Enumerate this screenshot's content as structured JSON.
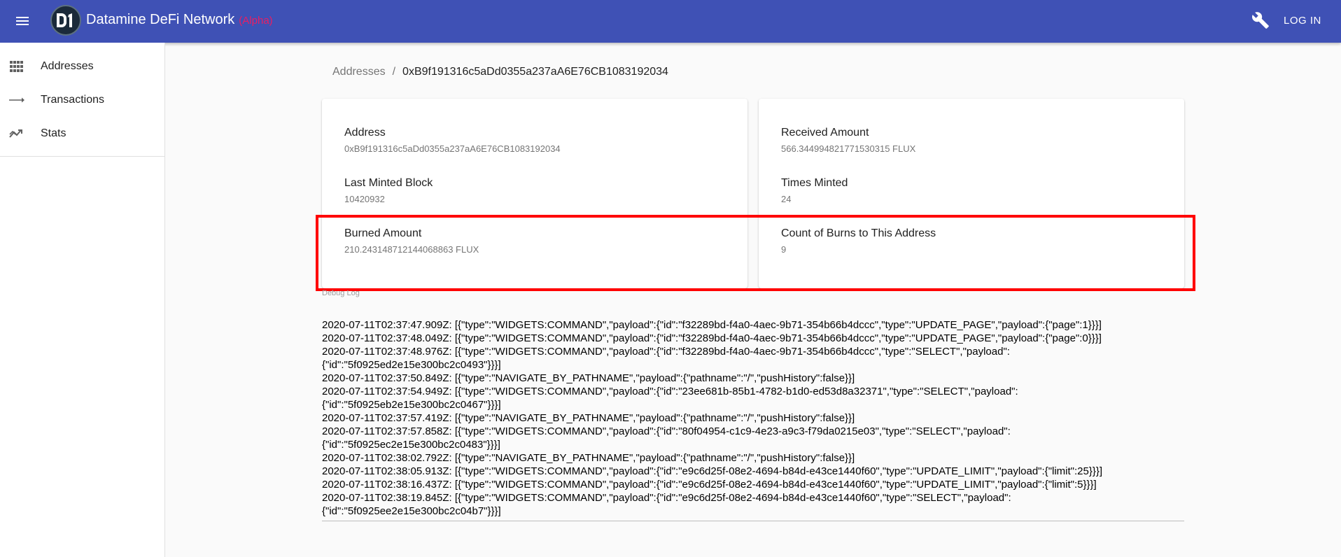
{
  "app": {
    "title": "Datamine DeFi Network",
    "badge": "(Alpha)",
    "login_label": "LOG IN",
    "logo_text": "D1"
  },
  "sidebar": {
    "items": [
      {
        "label": "Addresses",
        "icon": "grid-icon"
      },
      {
        "label": "Transactions",
        "icon": "arrow-right-icon"
      },
      {
        "label": "Stats",
        "icon": "trending-icon"
      }
    ]
  },
  "breadcrumb": {
    "parent": "Addresses",
    "separator": "/",
    "current": "0xB9f191316c5aDd0355a237aA6E76CB1083192034"
  },
  "details": {
    "address_label": "Address",
    "address_value": "0xB9f191316c5aDd0355a237aA6E76CB1083192034",
    "last_minted_label": "Last Minted Block",
    "last_minted_value": "10420932",
    "burned_label": "Burned Amount",
    "burned_value": "210.243148712144068863 FLUX",
    "received_label": "Received Amount",
    "received_value": "566.344994821771530315 FLUX",
    "times_minted_label": "Times Minted",
    "times_minted_value": "24",
    "burn_count_label": "Count of Burns to This Address",
    "burn_count_value": "9"
  },
  "debug": {
    "label": "Debug Log",
    "lines": [
      "2020-07-11T02:37:47.909Z: [{\"type\":\"WIDGETS:COMMAND\",\"payload\":{\"id\":\"f32289bd-f4a0-4aec-9b71-354b66b4dccc\",\"type\":\"UPDATE_PAGE\",\"payload\":{\"page\":1}}}]",
      "2020-07-11T02:37:48.049Z: [{\"type\":\"WIDGETS:COMMAND\",\"payload\":{\"id\":\"f32289bd-f4a0-4aec-9b71-354b66b4dccc\",\"type\":\"UPDATE_PAGE\",\"payload\":{\"page\":0}}}]",
      "2020-07-11T02:37:48.976Z: [{\"type\":\"WIDGETS:COMMAND\",\"payload\":{\"id\":\"f32289bd-f4a0-4aec-9b71-354b66b4dccc\",\"type\":\"SELECT\",\"payload\":{\"id\":\"5f0925ed2e15e300bc2c0493\"}}}]",
      "2020-07-11T02:37:50.849Z: [{\"type\":\"NAVIGATE_BY_PATHNAME\",\"payload\":{\"pathname\":\"/\",\"pushHistory\":false}}]",
      "2020-07-11T02:37:54.949Z: [{\"type\":\"WIDGETS:COMMAND\",\"payload\":{\"id\":\"23ee681b-85b1-4782-b1d0-ed53d8a32371\",\"type\":\"SELECT\",\"payload\":{\"id\":\"5f0925eb2e15e300bc2c0467\"}}}]",
      "2020-07-11T02:37:57.419Z: [{\"type\":\"NAVIGATE_BY_PATHNAME\",\"payload\":{\"pathname\":\"/\",\"pushHistory\":false}}]",
      "2020-07-11T02:37:57.858Z: [{\"type\":\"WIDGETS:COMMAND\",\"payload\":{\"id\":\"80f04954-c1c9-4e23-a9c3-f79da0215e03\",\"type\":\"SELECT\",\"payload\":{\"id\":\"5f0925ec2e15e300bc2c0483\"}}}]",
      "2020-07-11T02:38:02.792Z: [{\"type\":\"NAVIGATE_BY_PATHNAME\",\"payload\":{\"pathname\":\"/\",\"pushHistory\":false}}]",
      "2020-07-11T02:38:05.913Z: [{\"type\":\"WIDGETS:COMMAND\",\"payload\":{\"id\":\"e9c6d25f-08e2-4694-b84d-e43ce1440f60\",\"type\":\"UPDATE_LIMIT\",\"payload\":{\"limit\":25}}}]",
      "2020-07-11T02:38:16.437Z: [{\"type\":\"WIDGETS:COMMAND\",\"payload\":{\"id\":\"e9c6d25f-08e2-4694-b84d-e43ce1440f60\",\"type\":\"UPDATE_LIMIT\",\"payload\":{\"limit\":5}}}]",
      "2020-07-11T02:38:19.845Z: [{\"type\":\"WIDGETS:COMMAND\",\"payload\":{\"id\":\"e9c6d25f-08e2-4694-b84d-e43ce1440f60\",\"type\":\"SELECT\",\"payload\":{\"id\":\"5f0925ee2e15e300bc2c04b7\"}}}]"
    ]
  },
  "colors": {
    "appbar": "#3f51b5",
    "badge": "#e91e63",
    "highlight": "#ff0000"
  }
}
